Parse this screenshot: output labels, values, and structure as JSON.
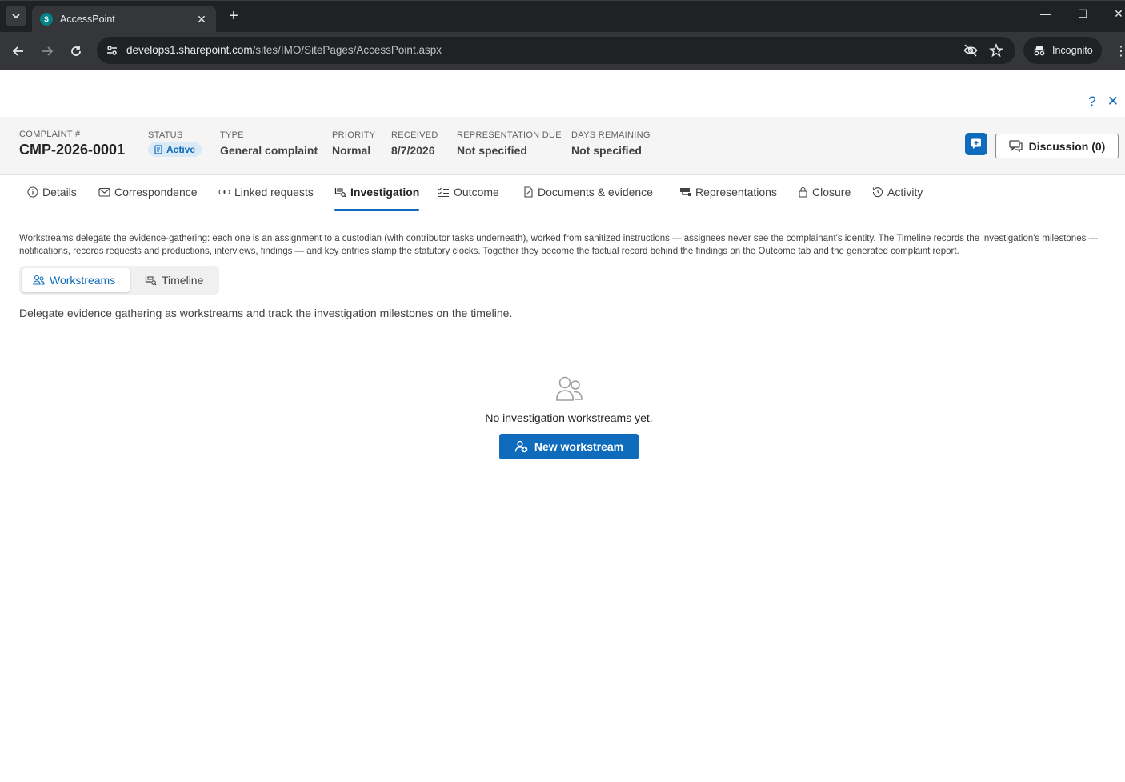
{
  "browser": {
    "tab_title": "AccessPoint",
    "tab_favicon_text": "S",
    "url_host": "develops1.sharepoint.com",
    "url_path": "/sites/IMO/SitePages/AccessPoint.aspx",
    "incognito_label": "Incognito"
  },
  "panel": {
    "help_glyph": "?",
    "close_glyph": "✕"
  },
  "header": {
    "complaint_label": "COMPLAINT #",
    "complaint_value": "CMP-2026-0001",
    "status_label": "STATUS",
    "status_value": "Active",
    "type_label": "TYPE",
    "type_value": "General complaint",
    "priority_label": "PRIORITY",
    "priority_value": "Normal",
    "received_label": "RECEIVED",
    "received_value": "8/7/2026",
    "representation_label": "REPRESENTATION DUE",
    "representation_value": "Not specified",
    "days_label": "DAYS REMAINING",
    "days_value": "Not specified",
    "discussion_label": "Discussion (0)"
  },
  "tabs": [
    {
      "label": "Details",
      "icon": "info-icon"
    },
    {
      "label": "Correspondence",
      "icon": "mail-icon"
    },
    {
      "label": "Linked requests",
      "icon": "link-icon"
    },
    {
      "label": "Investigation",
      "icon": "investigation-icon",
      "active": true
    },
    {
      "label": "Outcome",
      "icon": "checklist-icon"
    },
    {
      "label": "Documents & evidence",
      "icon": "document-icon"
    },
    {
      "label": "Representations",
      "icon": "representations-icon"
    },
    {
      "label": "Closure",
      "icon": "lock-icon"
    },
    {
      "label": "Activity",
      "icon": "history-icon"
    }
  ],
  "investigation": {
    "intro": "Workstreams delegate the evidence-gathering: each one is an assignment to a custodian (with contributor tasks underneath), worked from sanitized instructions — assignees never see the complainant's identity. The Timeline records the investigation's milestones — notifications, records requests and productions, interviews, findings — and key entries stamp the statutory clocks. Together they become the factual record behind the findings on the Outcome tab and the generated complaint report.",
    "segments": [
      {
        "label": "Workstreams",
        "active": true
      },
      {
        "label": "Timeline",
        "active": false
      }
    ],
    "subtitle": "Delegate evidence gathering as workstreams and track the investigation milestones on the timeline.",
    "empty_text": "No investigation workstreams yet.",
    "new_button": "New workstream"
  },
  "colors": {
    "accent": "#0f6cbd",
    "header_bg": "#f5f5f5",
    "chrome_dark": "#202124",
    "chrome_mid": "#35363a"
  }
}
